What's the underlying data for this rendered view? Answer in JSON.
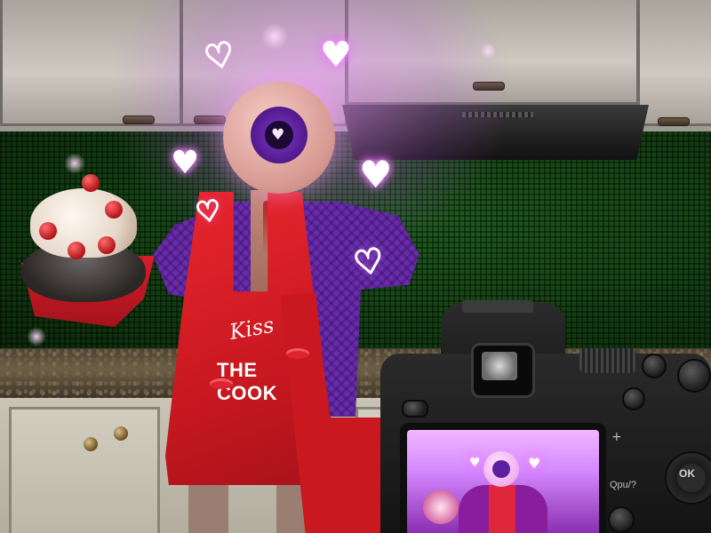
{
  "apron": {
    "line1": "Kiss",
    "line2": "THE COOK"
  },
  "camera": {
    "button_label": "Qpu/?",
    "ok_label": "OK",
    "plus_label": "+"
  },
  "colors": {
    "glow": "#e88cff",
    "apron": "#d61e2a",
    "sweater": "#6a2bb0",
    "eye": "#5b1f9a",
    "backsplash": "#123d12"
  },
  "icons": [
    "heart-icon",
    "heart-outline-icon",
    "camera-icon",
    "eye-icon"
  ],
  "hearts": {
    "glyph_solid": "♥",
    "glyph_outline": "♡"
  }
}
